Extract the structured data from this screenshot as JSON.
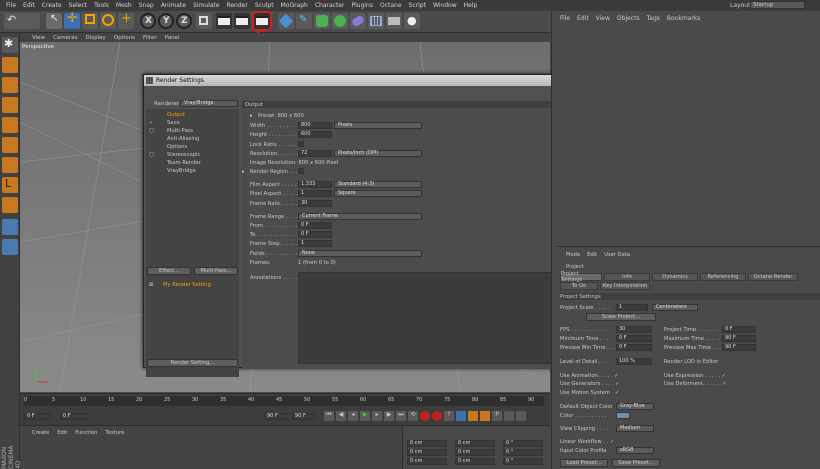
{
  "menu": [
    "File",
    "Edit",
    "Create",
    "Select",
    "Tools",
    "Mesh",
    "Snap",
    "Animate",
    "Simulate",
    "Render",
    "Sculpt",
    "MoGraph",
    "Character",
    "Plugins",
    "Octane",
    "Script",
    "Window",
    "Help"
  ],
  "layout": {
    "label": "Layout:",
    "value": "Startup"
  },
  "objects_menu": [
    "File",
    "Edit",
    "View",
    "Objects",
    "Tags",
    "Bookmarks"
  ],
  "viewport": {
    "label": "Perspective",
    "menu": [
      "View",
      "Cameras",
      "Display",
      "Options",
      "Filter",
      "Panel"
    ]
  },
  "render_settings": {
    "title": "Render Settings",
    "renderer_label": "Renderer",
    "renderer_value": "Vray/Bridge",
    "items": [
      {
        "label": "Output",
        "active": true,
        "check": ""
      },
      {
        "label": "Save",
        "active": false,
        "check": "✓"
      },
      {
        "label": "Multi-Pass",
        "active": false,
        "check": "□"
      },
      {
        "label": "Anti-Aliasing",
        "active": false,
        "check": ""
      },
      {
        "label": "Options",
        "active": false,
        "check": ""
      },
      {
        "label": "Stereoscopic",
        "active": false,
        "check": "□"
      },
      {
        "label": "Team Render",
        "active": false,
        "check": ""
      },
      {
        "label": "VrayBridge",
        "active": false,
        "check": ""
      }
    ],
    "effect_button": "Effect...",
    "multipass_button": "Multi-Pass...",
    "my_setting": "My Render Setting",
    "render_setting_button": "Render Setting...",
    "section_title": "Output",
    "preset": "Preset: 800 x 600",
    "fields": {
      "width_label": "Width . . . . . . . . .",
      "width": "800",
      "width_unit": "Pixels",
      "height_label": "Height . . . . . . . . .",
      "height": "600",
      "lock_label": "Lock Ratio . . . . . .",
      "res_label": "Resolution. . . . . . .",
      "res": "72",
      "res_unit": "Pixels/Inch (DPI)",
      "img_res": "Image Resolution: 800 x 600 Pixel",
      "region_label": "Render Region . . .",
      "film_label": "Film Aspect . . . . . .",
      "film": "1.333",
      "film_opt": "Standard (4:3)",
      "pixel_label": "Pixel Aspect . . . . .",
      "pixel": "1",
      "pixel_opt": "Square",
      "rate_label": "Frame Rate. . . . . .",
      "rate": "30",
      "range_label": "Frame Range . . . . .",
      "range": "Current Frame",
      "from_label": "From. . . . . . . . . . .",
      "from": "0 F",
      "to_label": "To . . . . . . . . . . . .",
      "to": "0 F",
      "step_label": "Frame Step. . . . . . .",
      "step": "1",
      "fields_label": "Fields . . . . . . . . . .",
      "fields": "None",
      "frames_label": "Frames:",
      "frames": "1 (from 0 to 0)",
      "annotations_label": "Annotations . . . . . ."
    }
  },
  "attributes": {
    "menu": [
      "Mode",
      "Edit",
      "User Data"
    ],
    "header": "Project",
    "tabs1": [
      "Project Settings",
      "Info",
      "Dynamics",
      "Referencing",
      "Octane Render"
    ],
    "tabs2": [
      "To Do",
      "Key Interpolation"
    ],
    "section": "Project Settings",
    "scale_label": "Project Scale . . . . .",
    "scale": "1",
    "scale_unit": "Centimeters",
    "scale_button": "Scale Project...",
    "fps_label": "FPS . . . . . . . . . . .",
    "fps": "30",
    "ptime_label": "Project Time . . . . . . .",
    "ptime": "0 F",
    "min_label": "Minimum Time . . .",
    "min": "0 F",
    "max_label": "Maximum Time . . . . . .",
    "max": "90 F",
    "pmin_label": "Preview Min Time . . .",
    "pmin": "0 F",
    "pmax_label": "Preview Max Time . . .",
    "pmax": "90 F",
    "lod_label": "Level of Detail . . .",
    "lod": "100 %",
    "lod_editor": "Render LOD in Editor",
    "anim": "Use Animation. . . . . ✓",
    "expr": "Use Expression . . . . . ✓",
    "gen": "Use Generators . . . . ✓",
    "deform": "Use Deformers. . . . . . ✓",
    "motion": "Use Motion System . ✓",
    "color_label": "Default Object Color",
    "color_value": "Gray-Blue",
    "color2": "Color . . . . . . . . . .",
    "clip_label": "View Clipping . . . . .",
    "clip_value": "Medium",
    "linear": "Linear Workflow . . ✓",
    "profile_label": "Input Color Profile",
    "profile_value": "sRGB",
    "load": "Load Preset...",
    "save": "Save Preset..."
  },
  "timeline": {
    "start": "0 F",
    "zero": "0 F",
    "end": "90 F",
    "end2": "90 F",
    "ticks": [
      "0",
      "5",
      "10",
      "15",
      "20",
      "25",
      "30",
      "35",
      "40",
      "45",
      "50",
      "55",
      "60",
      "65",
      "70",
      "75",
      "80",
      "85",
      "90"
    ]
  },
  "bottom_menu": [
    "Create",
    "Edit",
    "Function",
    "Texture"
  ],
  "coords": {
    "a": "0 cm",
    "b": "0 cm",
    "c": "0 cm",
    "d": "0 cm",
    "e": "0 cm",
    "f": "0 cm",
    "h": "0 °",
    "p": "0 °",
    "bb": "0 °"
  },
  "brand": "MAXON CINEMA 4D"
}
